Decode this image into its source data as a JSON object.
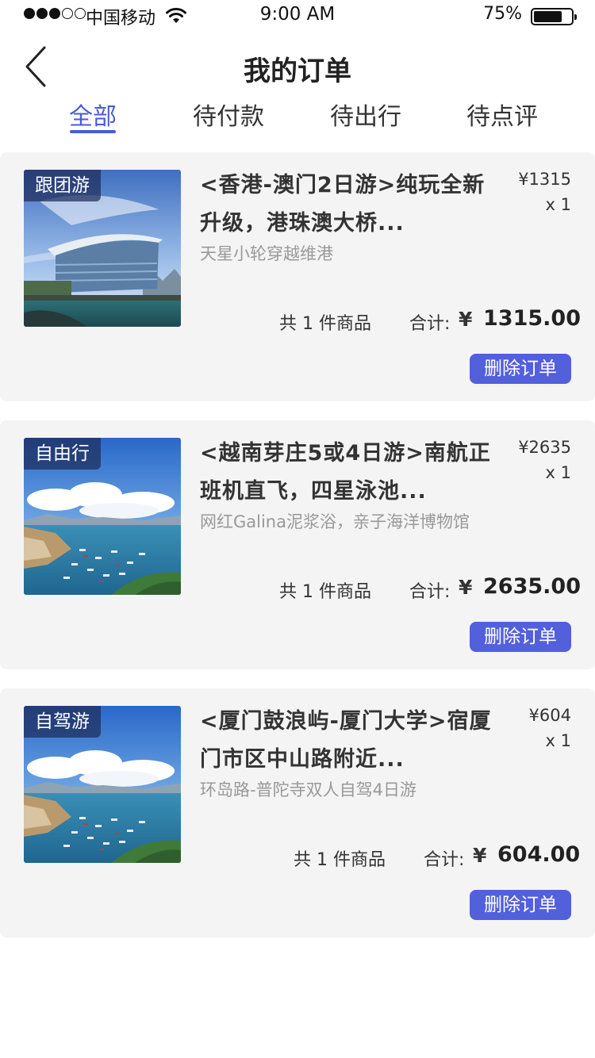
{
  "status_bar": {
    "signal_filled": 3,
    "signal_total": 5,
    "carrier": "中国移动",
    "time": "9:00 AM",
    "battery_text": "75%",
    "battery_level": 0.75
  },
  "nav": {
    "title": "我的订单",
    "back_icon": "chevron-left-icon"
  },
  "tabs": [
    {
      "label": "全部",
      "active": true
    },
    {
      "label": "待付款",
      "active": false
    },
    {
      "label": "待出行",
      "active": false
    },
    {
      "label": "待点评",
      "active": false
    }
  ],
  "orders": [
    {
      "tag": "跟团游",
      "title": "<香港-澳门2日游>纯玩全新升级，港珠澳大桥...",
      "subtitle": "天星小轮穿越维港",
      "price": "¥1315",
      "qty": "x 1",
      "count_text": "共 1 件商品",
      "total_label": "合计:",
      "total_currency": "¥",
      "total_value": "1315.00",
      "delete_label": "删除订单",
      "image": "convention-center"
    },
    {
      "tag": "自由行",
      "title": "<越南芽庄5或4日游>南航正班机直飞，四星泳池...",
      "subtitle": "网红Galina泥浆浴，亲子海洋博物馆",
      "price": "¥2635",
      "qty": "x 1",
      "count_text": "共 1 件商品",
      "total_label": "合计:",
      "total_currency": "¥",
      "total_value": "2635.00",
      "delete_label": "删除订单",
      "image": "harbor-boats"
    },
    {
      "tag": "自驾游",
      "title": "<厦门鼓浪屿-厦门大学>宿厦门市区中山路附近...",
      "subtitle": "环岛路-普陀寺双人自驾4日游",
      "price": "¥604",
      "qty": "x 1",
      "count_text": "共 1 件商品",
      "total_label": "合计:",
      "total_currency": "¥",
      "total_value": "604.00",
      "delete_label": "删除订单",
      "image": "harbor-boats"
    }
  ],
  "colors": {
    "accent": "#4a5bd4",
    "button": "#5260dc",
    "card_bg": "#f4f4f5",
    "muted_text": "#999999"
  }
}
